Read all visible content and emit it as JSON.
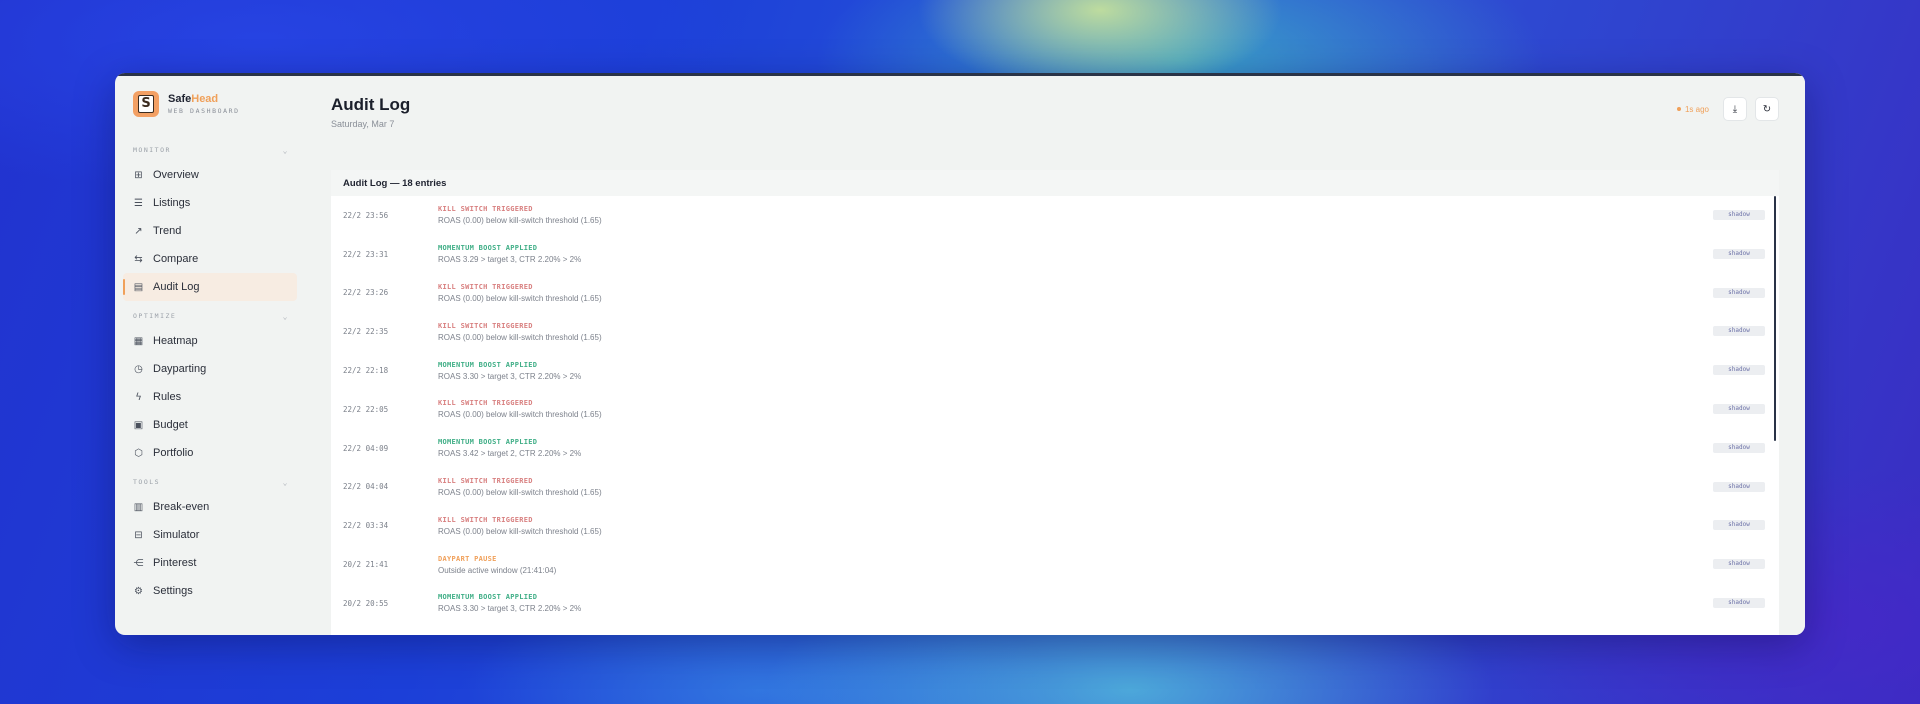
{
  "brand": {
    "name_a": "Safe",
    "name_b": "Head",
    "subtitle": "WEB DASHBOARD"
  },
  "sidebar": {
    "sections": [
      {
        "label": "MONITOR",
        "items": [
          {
            "label": "Overview",
            "icon": "grid-icon"
          },
          {
            "label": "Listings",
            "icon": "list-icon"
          },
          {
            "label": "Trend",
            "icon": "trend-icon"
          },
          {
            "label": "Compare",
            "icon": "compare-icon"
          },
          {
            "label": "Audit Log",
            "icon": "audit-icon",
            "active": true
          }
        ]
      },
      {
        "label": "OPTIMIZE",
        "items": [
          {
            "label": "Heatmap",
            "icon": "map-icon"
          },
          {
            "label": "Dayparting",
            "icon": "clock-icon"
          },
          {
            "label": "Rules",
            "icon": "bolt-icon"
          },
          {
            "label": "Budget",
            "icon": "wallet-icon"
          },
          {
            "label": "Portfolio",
            "icon": "hexagon-icon"
          }
        ]
      },
      {
        "label": "TOOLS",
        "items": [
          {
            "label": "Break-even",
            "icon": "calculator-icon"
          },
          {
            "label": "Simulator",
            "icon": "simulator-icon"
          },
          {
            "label": "Pinterest",
            "icon": "share-icon"
          },
          {
            "label": "Settings",
            "icon": "gear-icon"
          }
        ]
      }
    ]
  },
  "header": {
    "title": "Audit Log",
    "date": "Saturday, Mar 7",
    "ago": "1s ago"
  },
  "panel": {
    "title": "Audit Log — 18 entries"
  },
  "entries": [
    {
      "time": "22/2 23:56",
      "event": "KILL SWITCH TRIGGERED",
      "kind": "kill",
      "desc": "ROAS (0.00) below kill-switch threshold (1.65)",
      "badge": "shadow"
    },
    {
      "time": "22/2 23:31",
      "event": "MOMENTUM BOOST APPLIED",
      "kind": "boost",
      "desc": "ROAS 3.29 > target 3, CTR 2.20% > 2%",
      "badge": "shadow"
    },
    {
      "time": "22/2 23:26",
      "event": "KILL SWITCH TRIGGERED",
      "kind": "kill",
      "desc": "ROAS (0.00) below kill-switch threshold (1.65)",
      "badge": "shadow"
    },
    {
      "time": "22/2 22:35",
      "event": "KILL SWITCH TRIGGERED",
      "kind": "kill",
      "desc": "ROAS (0.00) below kill-switch threshold (1.65)",
      "badge": "shadow"
    },
    {
      "time": "22/2 22:18",
      "event": "MOMENTUM BOOST APPLIED",
      "kind": "boost",
      "desc": "ROAS 3.30 > target 3, CTR 2.20% > 2%",
      "badge": "shadow"
    },
    {
      "time": "22/2 22:05",
      "event": "KILL SWITCH TRIGGERED",
      "kind": "kill",
      "desc": "ROAS (0.00) below kill-switch threshold (1.65)",
      "badge": "shadow"
    },
    {
      "time": "22/2 04:09",
      "event": "MOMENTUM BOOST APPLIED",
      "kind": "boost",
      "desc": "ROAS 3.42 > target 2, CTR 2.20% > 2%",
      "badge": "shadow"
    },
    {
      "time": "22/2 04:04",
      "event": "KILL SWITCH TRIGGERED",
      "kind": "kill",
      "desc": "ROAS (0.00) below kill-switch threshold (1.65)",
      "badge": "shadow"
    },
    {
      "time": "22/2 03:34",
      "event": "KILL SWITCH TRIGGERED",
      "kind": "kill",
      "desc": "ROAS (0.00) below kill-switch threshold (1.65)",
      "badge": "shadow"
    },
    {
      "time": "20/2 21:41",
      "event": "DAYPART PAUSE",
      "kind": "day",
      "desc": "Outside active window (21:41:04)",
      "badge": "shadow"
    },
    {
      "time": "20/2 20:55",
      "event": "MOMENTUM BOOST APPLIED",
      "kind": "boost",
      "desc": "ROAS 3.30 > target 3, CTR 2.20% > 2%",
      "badge": "shadow"
    }
  ],
  "colors": {
    "accent": "#f0a05a",
    "kill": "#d87f7f",
    "boost": "#3fae86"
  }
}
